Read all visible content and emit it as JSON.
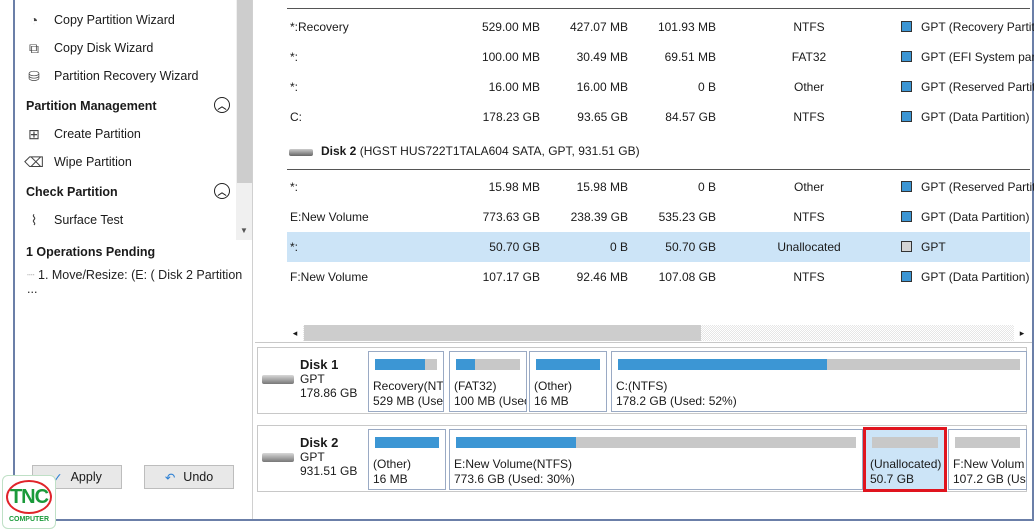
{
  "sidebar": {
    "wizards": [
      {
        "label": "Copy Partition Wizard",
        "icon": "copy-partition-icon"
      },
      {
        "label": "Copy Disk Wizard",
        "icon": "copy-disk-icon"
      },
      {
        "label": "Partition Recovery Wizard",
        "icon": "partition-recovery-icon"
      }
    ],
    "partition_management": {
      "title": "Partition Management",
      "items": [
        {
          "label": "Create Partition",
          "icon": "create-partition-icon"
        },
        {
          "label": "Wipe Partition",
          "icon": "eraser-icon"
        }
      ]
    },
    "check_partition": {
      "title": "Check Partition",
      "items": [
        {
          "label": "Surface Test",
          "icon": "surface-test-icon"
        }
      ]
    },
    "pending": {
      "title": "1 Operations Pending",
      "items": [
        "1. Move/Resize: (E: ( Disk 2 Partition ..."
      ]
    },
    "apply_label": "Apply",
    "undo_label": "Undo"
  },
  "table": {
    "disk1_rows": [
      {
        "name": "*:Recovery",
        "capacity": "529.00 MB",
        "used": "427.07 MB",
        "unused": "101.93 MB",
        "fs": "NTFS",
        "type": "GPT (Recovery Partit",
        "color": "#3c96d4"
      },
      {
        "name": "*:",
        "capacity": "100.00 MB",
        "used": "30.49 MB",
        "unused": "69.51 MB",
        "fs": "FAT32",
        "type": "GPT (EFI System part",
        "color": "#3c96d4"
      },
      {
        "name": "*:",
        "capacity": "16.00 MB",
        "used": "16.00 MB",
        "unused": "0 B",
        "fs": "Other",
        "type": "GPT (Reserved Partit",
        "color": "#3c96d4"
      },
      {
        "name": "C:",
        "capacity": "178.23 GB",
        "used": "93.65 GB",
        "unused": "84.57 GB",
        "fs": "NTFS",
        "type": "GPT (Data Partition)",
        "color": "#3c96d4"
      }
    ],
    "disk2_header": {
      "name": "Disk 2",
      "detail": "(HGST HUS722T1TALA604 SATA, GPT, 931.51 GB)"
    },
    "disk2_rows": [
      {
        "name": "*:",
        "capacity": "15.98 MB",
        "used": "15.98 MB",
        "unused": "0 B",
        "fs": "Other",
        "type": "GPT (Reserved Partit",
        "color": "#3c96d4"
      },
      {
        "name": "E:New Volume",
        "capacity": "773.63 GB",
        "used": "238.39 GB",
        "unused": "535.23 GB",
        "fs": "NTFS",
        "type": "GPT (Data Partition)",
        "color": "#3c96d4"
      },
      {
        "name": "*:",
        "capacity": "50.70 GB",
        "used": "0 B",
        "unused": "50.70 GB",
        "fs": "Unallocated",
        "type": "GPT",
        "color": "#d4d4d4",
        "selected": true
      },
      {
        "name": "F:New Volume",
        "capacity": "107.17 GB",
        "used": "92.46 MB",
        "unused": "107.08 GB",
        "fs": "NTFS",
        "type": "GPT (Data Partition)",
        "color": "#3c96d4"
      }
    ]
  },
  "disk_map": [
    {
      "name": "Disk 1",
      "style": "GPT",
      "size": "178.86 GB",
      "partitions": [
        {
          "l1": "Recovery(NTI",
          "l2": "529 MB (Usec",
          "used_pct": 81
        },
        {
          "l1": "(FAT32)",
          "l2": "100 MB (Usec",
          "used_pct": 30
        },
        {
          "l1": "(Other)",
          "l2": "16 MB",
          "used_pct": 100
        },
        {
          "l1": "C:(NTFS)",
          "l2": "178.2 GB (Used: 52%)",
          "used_pct": 52
        }
      ]
    },
    {
      "name": "Disk 2",
      "style": "GPT",
      "size": "931.51 GB",
      "partitions": [
        {
          "l1": "(Other)",
          "l2": "16 MB",
          "used_pct": 100
        },
        {
          "l1": "E:New Volume(NTFS)",
          "l2": "773.6 GB (Used: 30%)",
          "used_pct": 30
        },
        {
          "l1": "(Unallocated)",
          "l2": "50.7 GB",
          "used_pct": 0,
          "highlighted": true
        },
        {
          "l1": "F:New Volum",
          "l2": "107.2 GB (Use",
          "used_pct": 0
        }
      ]
    }
  ],
  "logo": {
    "text": "TNC",
    "sub": "COMPUTER",
    "color": "#1a9a3a"
  }
}
